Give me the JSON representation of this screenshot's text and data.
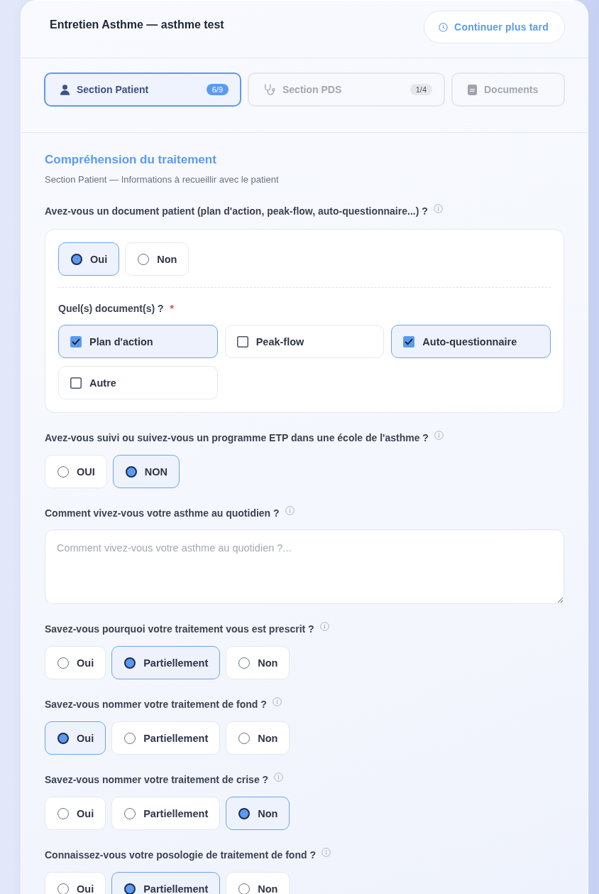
{
  "header": {
    "title": "Entretien Asthme — asthme test",
    "action": "Continuer plus tard"
  },
  "tabs": [
    {
      "label": "Section Patient",
      "count": "6/9",
      "selected": true
    },
    {
      "label": "Section PDS",
      "count": "1/4",
      "selected": false
    },
    {
      "label": "Documents",
      "selected": false
    }
  ],
  "section": {
    "title": "Compréhension du traitement",
    "subtitle": "Section Patient — Informations à recueillir avec le patient"
  },
  "questions": [
    {
      "kind": "radio",
      "label": "Avez-vous un document patient (plan d'action, peak-flow, auto-questionnaire...) ?",
      "options": [
        {
          "label": "Oui",
          "selected": true
        },
        {
          "label": "Non",
          "selected": false
        }
      ],
      "followup": {
        "label": "Quel(s) document(s) ?",
        "required_mark": "*",
        "options": [
          {
            "label": "Plan d'action",
            "checked": true
          },
          {
            "label": "Peak-flow",
            "checked": false
          },
          {
            "label": "Auto-questionnaire",
            "checked": true
          },
          {
            "label": "Autre",
            "checked": false
          }
        ]
      }
    },
    {
      "kind": "radio",
      "label": "Avez-vous suivi ou suivez-vous un programme ETP dans une école de l'asthme ?",
      "options": [
        {
          "label": "OUI",
          "selected": false
        },
        {
          "label": "NON",
          "selected": true
        }
      ]
    },
    {
      "kind": "text",
      "label": "Comment vivez-vous votre asthme au quotidien ?",
      "placeholder": "Comment vivez-vous votre asthme au quotidien ?..."
    },
    {
      "kind": "radio",
      "label": "Savez-vous pourquoi votre traitement vous est prescrit ?",
      "options": [
        {
          "label": "Oui",
          "selected": false
        },
        {
          "label": "Partiellement",
          "selected": true
        },
        {
          "label": "Non",
          "selected": false
        }
      ]
    },
    {
      "kind": "radio",
      "label": "Savez-vous nommer votre traitement de fond ?",
      "options": [
        {
          "label": "Oui",
          "selected": true
        },
        {
          "label": "Partiellement",
          "selected": false
        },
        {
          "label": "Non",
          "selected": false
        }
      ]
    },
    {
      "kind": "radio",
      "label": "Savez-vous nommer votre traitement de crise ?",
      "options": [
        {
          "label": "Oui",
          "selected": false
        },
        {
          "label": "Partiellement",
          "selected": false
        },
        {
          "label": "Non",
          "selected": true
        }
      ]
    },
    {
      "kind": "radio",
      "label": "Connaissez-vous votre posologie de traitement de fond ?",
      "options": [
        {
          "label": "Oui",
          "selected": false
        },
        {
          "label": "Partiellement",
          "selected": true
        },
        {
          "label": "Non",
          "selected": false
        }
      ]
    }
  ]
}
